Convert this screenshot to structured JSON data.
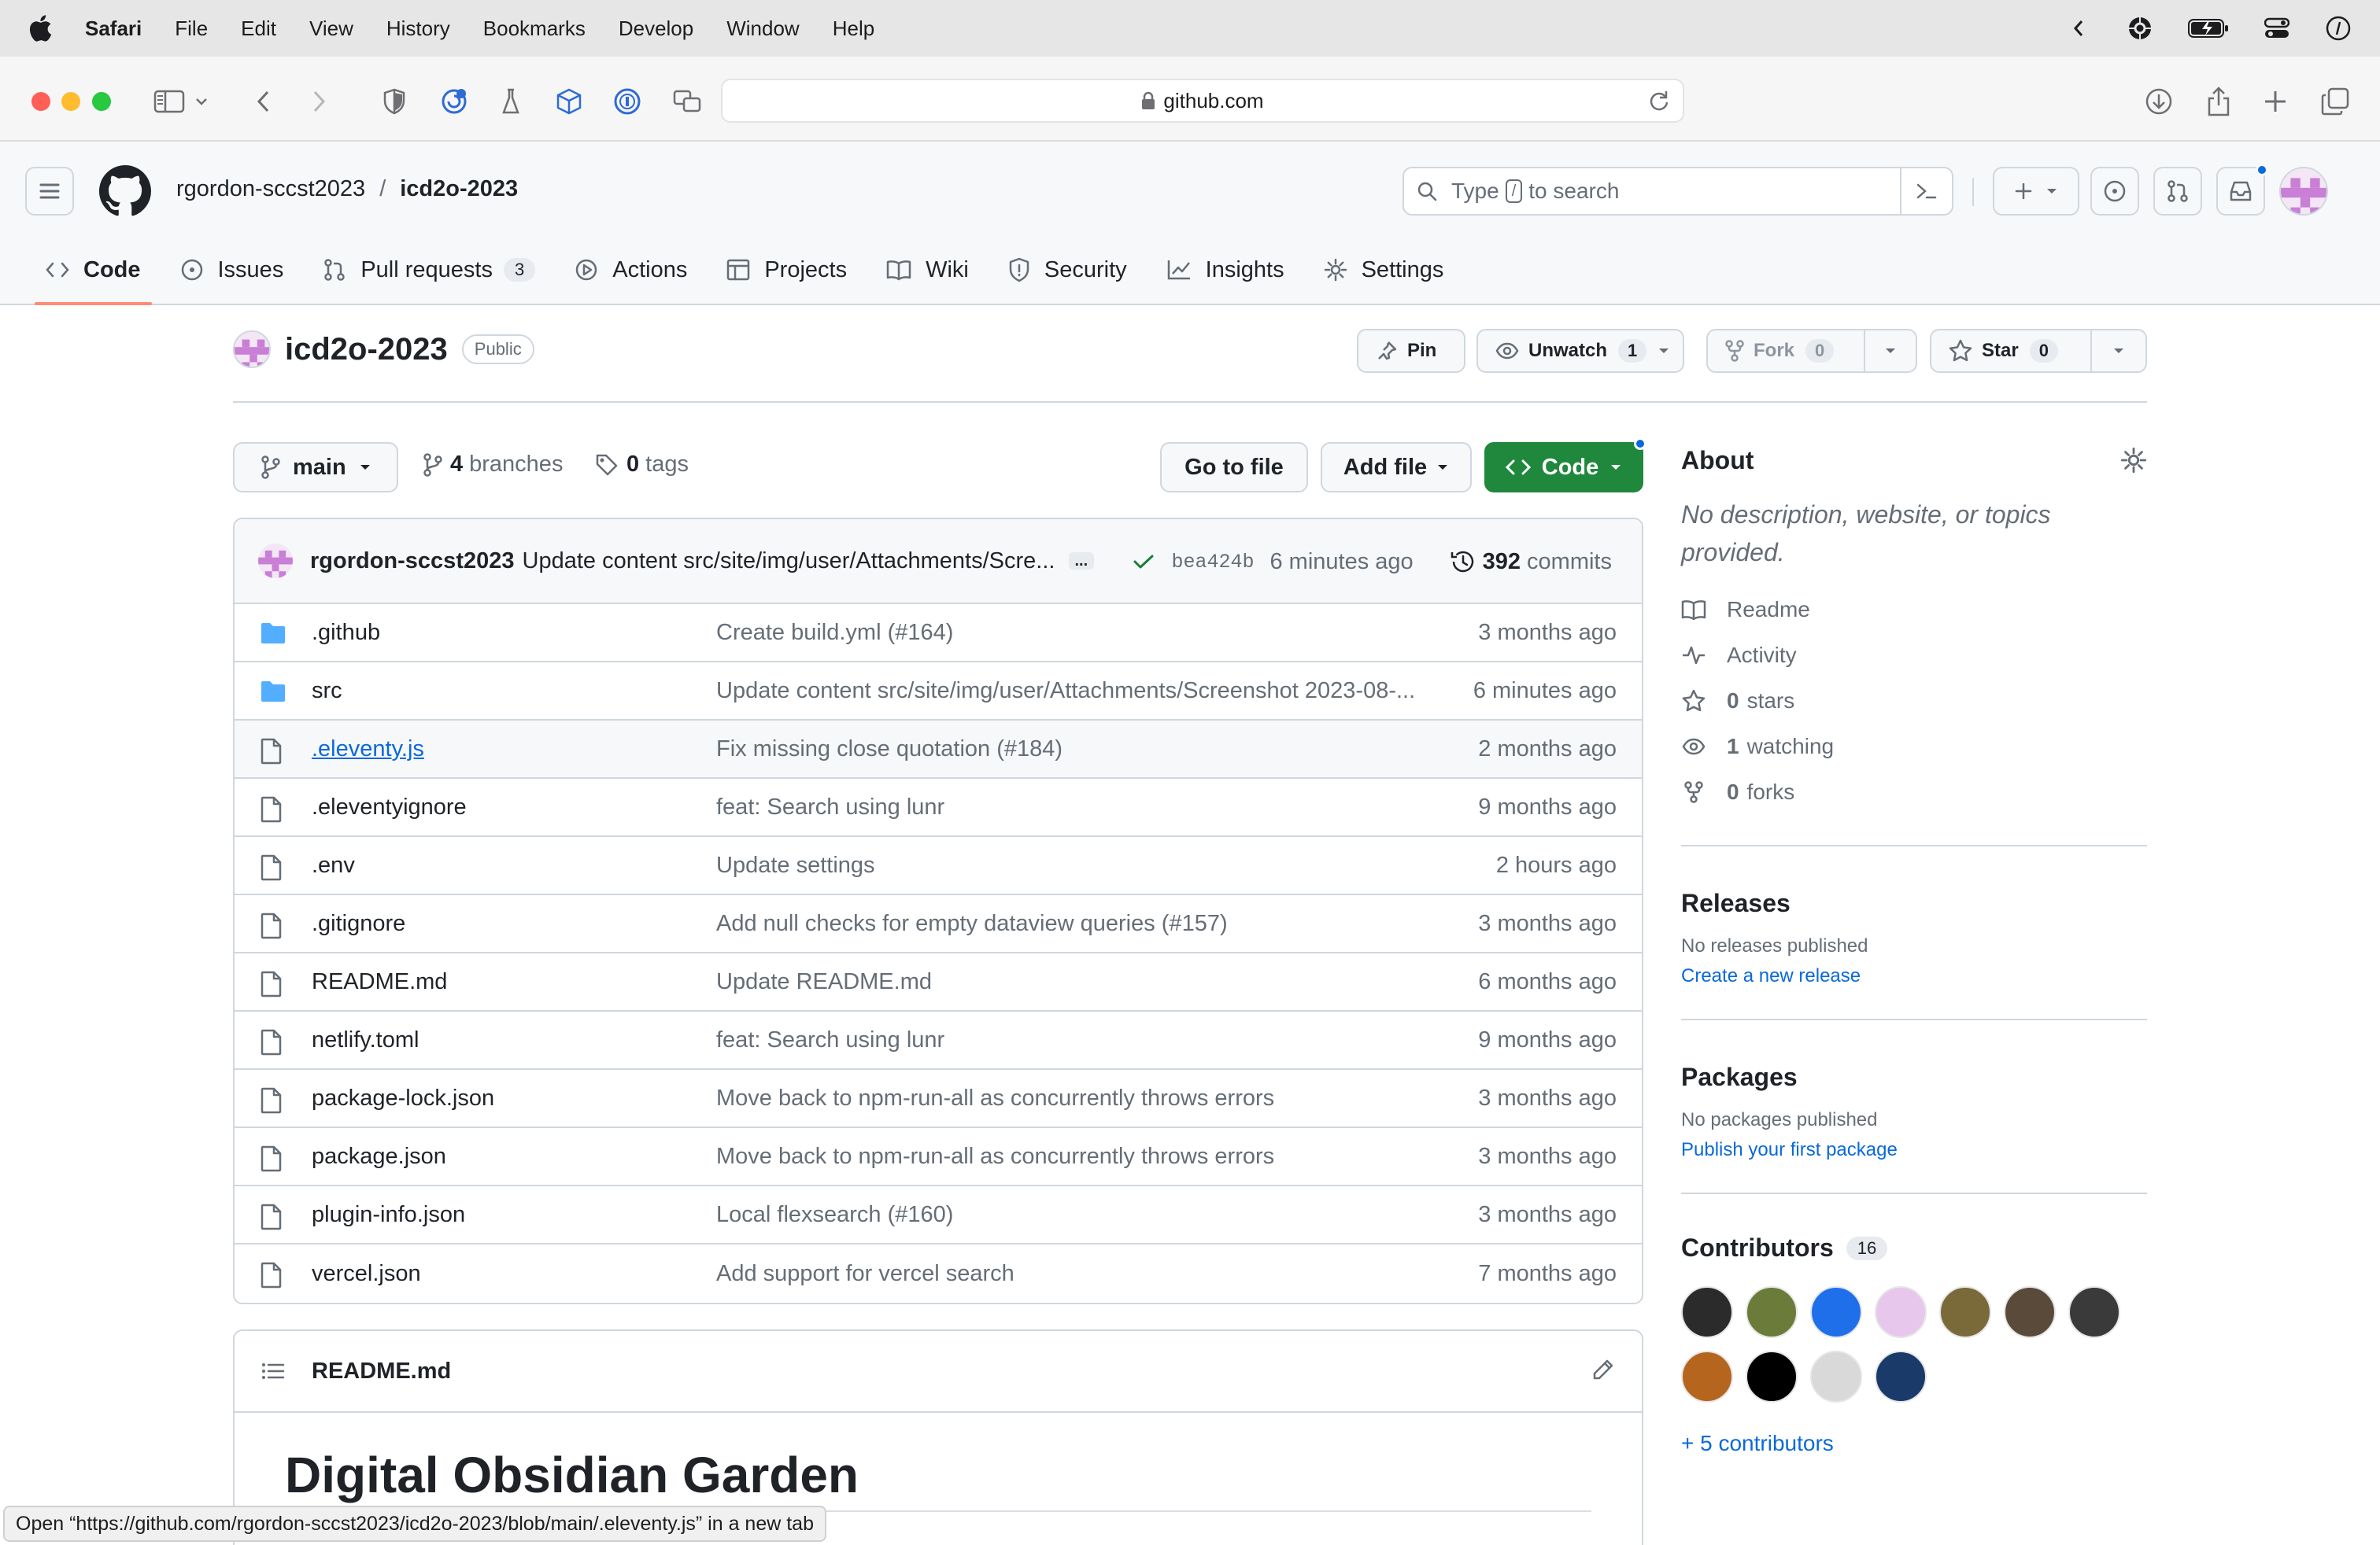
{
  "menubar": {
    "app": "Safari",
    "items": [
      "File",
      "Edit",
      "View",
      "History",
      "Bookmarks",
      "Develop",
      "Window",
      "Help"
    ]
  },
  "safari": {
    "url": "github.com"
  },
  "header": {
    "owner": "rgordon-sccst2023",
    "separator": "/",
    "repo": "icd2o-2023",
    "search_pre": "Type",
    "search_key": "/",
    "search_post": "to search"
  },
  "nav": {
    "tabs": [
      {
        "label": "Code",
        "icon": "code-icon"
      },
      {
        "label": "Issues",
        "icon": "issue-opened-icon"
      },
      {
        "label": "Pull requests",
        "icon": "git-pull-request-icon",
        "count": "3"
      },
      {
        "label": "Actions",
        "icon": "play-icon"
      },
      {
        "label": "Projects",
        "icon": "table-icon"
      },
      {
        "label": "Wiki",
        "icon": "book-icon"
      },
      {
        "label": "Security",
        "icon": "shield-icon"
      },
      {
        "label": "Insights",
        "icon": "graph-icon"
      },
      {
        "label": "Settings",
        "icon": "gear-icon"
      }
    ]
  },
  "repo": {
    "name": "icd2o-2023",
    "visibility": "Public",
    "pin": "Pin",
    "unwatch": "Unwatch",
    "watch_count": "1",
    "fork": "Fork",
    "fork_count": "0",
    "star": "Star",
    "star_count": "0"
  },
  "branch": {
    "name": "main",
    "branches_count": "4",
    "branches_label": "branches",
    "tags_count": "0",
    "tags_label": "tags",
    "go_to_file": "Go to file",
    "add_file": "Add file",
    "code": "Code"
  },
  "latest_commit": {
    "author": "rgordon-sccst2023",
    "message": "Update content src/site/img/user/Attachments/Scre...",
    "ellipsis": "...",
    "sha": "bea424b",
    "age": "6 minutes ago",
    "commits_count": "392",
    "commits_label": "commits"
  },
  "files": [
    {
      "name": ".github",
      "type": "folder",
      "message": "Create build.yml (#164)",
      "age": "3 months ago"
    },
    {
      "name": "src",
      "type": "folder",
      "message": "Update content src/site/img/user/Attachments/Screenshot 2023-08-...",
      "age": "6 minutes ago"
    },
    {
      "name": ".eleventy.js",
      "type": "file",
      "message": "Fix missing close quotation (#184)",
      "age": "2 months ago"
    },
    {
      "name": ".eleventyignore",
      "type": "file",
      "message": "feat: Search using lunr",
      "age": "9 months ago"
    },
    {
      "name": ".env",
      "type": "file",
      "message": "Update settings",
      "age": "2 hours ago"
    },
    {
      "name": ".gitignore",
      "type": "file",
      "message": "Add null checks for empty dataview queries (#157)",
      "age": "3 months ago"
    },
    {
      "name": "README.md",
      "type": "file",
      "message": "Update README.md",
      "age": "6 months ago"
    },
    {
      "name": "netlify.toml",
      "type": "file",
      "message": "feat: Search using lunr",
      "age": "9 months ago"
    },
    {
      "name": "package-lock.json",
      "type": "file",
      "message": "Move back to npm-run-all as concurrently throws errors",
      "age": "3 months ago"
    },
    {
      "name": "package.json",
      "type": "file",
      "message": "Move back to npm-run-all as concurrently throws errors",
      "age": "3 months ago"
    },
    {
      "name": "plugin-info.json",
      "type": "file",
      "message": "Local flexsearch (#160)",
      "age": "3 months ago"
    },
    {
      "name": "vercel.json",
      "type": "file",
      "message": "Add support for vercel search",
      "age": "7 months ago"
    }
  ],
  "readme": {
    "filename": "README.md",
    "heading": "Digital Obsidian Garden"
  },
  "about": {
    "title": "About",
    "description": "No description, website, or topics provided.",
    "readme": "Readme",
    "activity": "Activity",
    "stars_count": "0",
    "stars_label": "stars",
    "watching_count": "1",
    "watching_label": "watching",
    "forks_count": "0",
    "forks_label": "forks"
  },
  "releases": {
    "title": "Releases",
    "none": "No releases published",
    "create": "Create a new release"
  },
  "packages": {
    "title": "Packages",
    "none": "No packages published",
    "publish": "Publish your first package"
  },
  "contributors": {
    "title": "Contributors",
    "count": "16",
    "more": "+ 5 contributors",
    "avatars": [
      "#2b2b2b",
      "#6b7b3a",
      "#1f6feb",
      "#e8c7ec",
      "#7a6a3a",
      "#5a4a3a",
      "#3a3a3a",
      "#b5651d",
      "#000000",
      "#d9d9d9",
      "#1a3a6a"
    ]
  },
  "statusbar": {
    "text": "Open “https://github.com/rgordon-sccst2023/icd2o-2023/blob/main/.eleventy.js” in a new tab"
  },
  "colors": {
    "accent": "#0969da",
    "primary_button": "#1f883d",
    "folder": "#54aeff",
    "tab_underline": "#fd8c73"
  }
}
